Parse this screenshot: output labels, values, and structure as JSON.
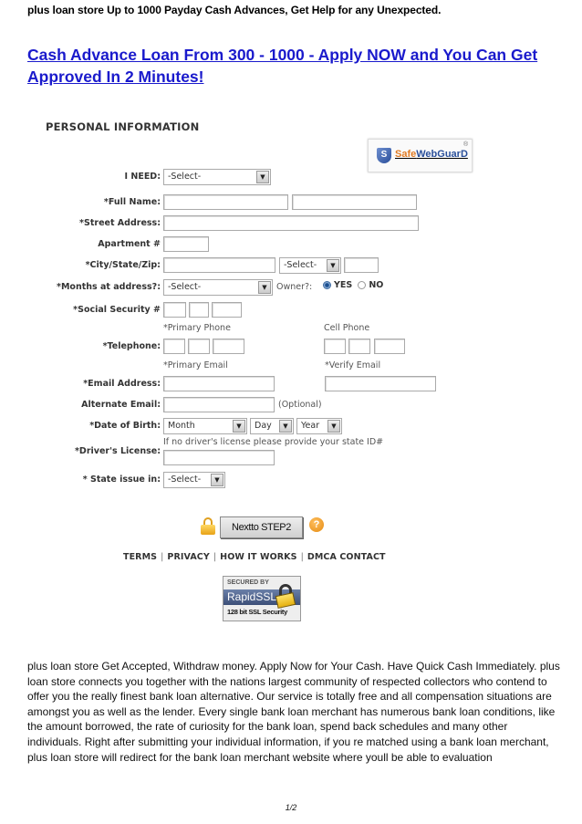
{
  "doc_header": "plus loan store Up to 1000 Payday Cash Advances, Get Help for any Unexpected.",
  "headline": "Cash Advance Loan From 300 - 1000 - Apply NOW and You Can Get Approved In 2 Minutes! ",
  "form": {
    "section_title": "PERSONAL INFORMATION",
    "trust_badge": {
      "part1": "Safe",
      "part2": "WebGuarD",
      "reg": "®",
      "shield_letter": "S"
    },
    "fields": {
      "i_need": {
        "label": "I NEED:",
        "value": "-Select-"
      },
      "full_name": {
        "label": "*Full Name:"
      },
      "street_address": {
        "label": "*Street Address:"
      },
      "apartment": {
        "label": "Apartment #"
      },
      "city_state_zip": {
        "label": "*City/State/Zip:",
        "state_value": "-Select-"
      },
      "months_at_address": {
        "label": "*Months at address?:",
        "value": "-Select-"
      },
      "owner": {
        "label": "Owner?:",
        "options": [
          "YES",
          "NO"
        ],
        "selected": "YES"
      },
      "ssn": {
        "label": "*Social Security #"
      },
      "telephone": {
        "label": "*Telephone:",
        "primary_label": "*Primary Phone",
        "cell_label": "Cell Phone"
      },
      "email": {
        "label": "*Email Address:",
        "primary_label": "*Primary Email",
        "verify_label": "*Verify Email"
      },
      "alternate_email": {
        "label": "Alternate Email:",
        "note": "(Optional)"
      },
      "dob": {
        "label": "*Date of Birth:",
        "month": "Month",
        "day": "Day",
        "year": "Year"
      },
      "drivers_license": {
        "label": "*Driver's License:",
        "hint": "If no driver's license please provide your state ID#"
      },
      "state_issue": {
        "label": "* State issue in:",
        "value": "-Select-"
      }
    },
    "next_button": "Nextto STEP2",
    "help_symbol": "?",
    "footer_links": [
      "TERMS",
      "PRIVACY",
      "HOW IT WORKS",
      "DMCA CONTACT"
    ],
    "ssl_badge": {
      "top": "SECURED BY",
      "brand": "RapidSSL",
      "bottom": "128 bit SSL Security"
    }
  },
  "body_text": "plus loan store Get Accepted, Withdraw money. Apply Now for Your Cash. Have Quick Cash Immediately. plus loan store connects you together with the nations largest community of respected collectors who contend to offer you the really finest bank loan alternative. Our service is totally free and all compensation situations are amongst you as well as the lender. Every single bank loan merchant has numerous bank loan conditions, like the amount borrowed, the rate of curiosity for the bank loan, spend back schedules and many other individuals. Right after submitting your individual information, if you re matched using a bank loan merchant, plus loan store will redirect for the bank loan merchant website where youll be able to evaluation",
  "page_number": "1/2",
  "colors": {
    "headline": "#1a1acc",
    "safe_orange": "#e07b24",
    "guard_blue": "#2a4f9a"
  }
}
